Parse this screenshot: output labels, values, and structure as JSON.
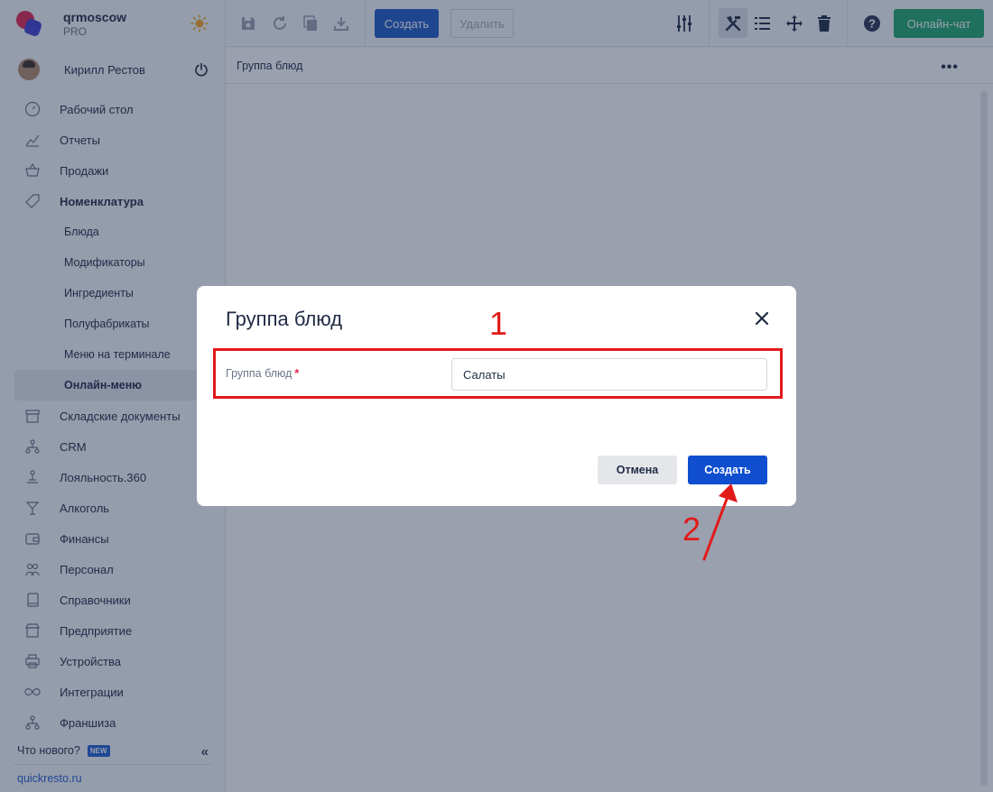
{
  "brand": {
    "name": "qrmoscow",
    "plan": "PRO"
  },
  "user": {
    "name": "Кирилл Рестов"
  },
  "nav": {
    "items": [
      {
        "label": "Рабочий стол",
        "icon": "speedometer-icon"
      },
      {
        "label": "Отчеты",
        "icon": "chart-line-icon"
      },
      {
        "label": "Продажи",
        "icon": "basket-icon"
      },
      {
        "label": "Номенклатура",
        "icon": "tag-icon"
      }
    ],
    "sub_items": [
      {
        "label": "Блюда"
      },
      {
        "label": "Модификаторы"
      },
      {
        "label": "Ингредиенты"
      },
      {
        "label": "Полуфабрикаты"
      },
      {
        "label": "Меню на терминале"
      },
      {
        "label": "Онлайн-меню"
      }
    ],
    "items_after": [
      {
        "label": "Складские документы",
        "icon": "archive-icon"
      },
      {
        "label": "CRM",
        "icon": "hierarchy-icon"
      },
      {
        "label": "Лояльность.360",
        "icon": "loyalty-icon"
      },
      {
        "label": "Алкоголь",
        "icon": "cocktail-icon"
      },
      {
        "label": "Финансы",
        "icon": "wallet-icon"
      },
      {
        "label": "Персонал",
        "icon": "people-icon"
      },
      {
        "label": "Справочники",
        "icon": "book-icon"
      },
      {
        "label": "Предприятие",
        "icon": "store-icon"
      },
      {
        "label": "Устройства",
        "icon": "printer-icon"
      },
      {
        "label": "Интеграции",
        "icon": "infinity-icon"
      },
      {
        "label": "Франшиза",
        "icon": "franchise-icon"
      }
    ]
  },
  "footer": {
    "whatsnew": "Что нового?",
    "badge": "NEW",
    "site": "quickresto.ru"
  },
  "toolbar": {
    "create_label": "Создать",
    "delete_label": "Удалить",
    "chat_label": "Онлайн-чат"
  },
  "content": {
    "header": "Группа блюд"
  },
  "modal": {
    "title": "Группа блюд",
    "field_label": "Группа блюд",
    "required_mark": "*",
    "field_value": "Салаты",
    "cancel_label": "Отмена",
    "submit_label": "Создать"
  },
  "annotations": {
    "step1": "1",
    "step2": "2"
  },
  "colors": {
    "accent": "#0f4fcf",
    "chat": "#20a86c",
    "annotation": "#e21a1a"
  }
}
